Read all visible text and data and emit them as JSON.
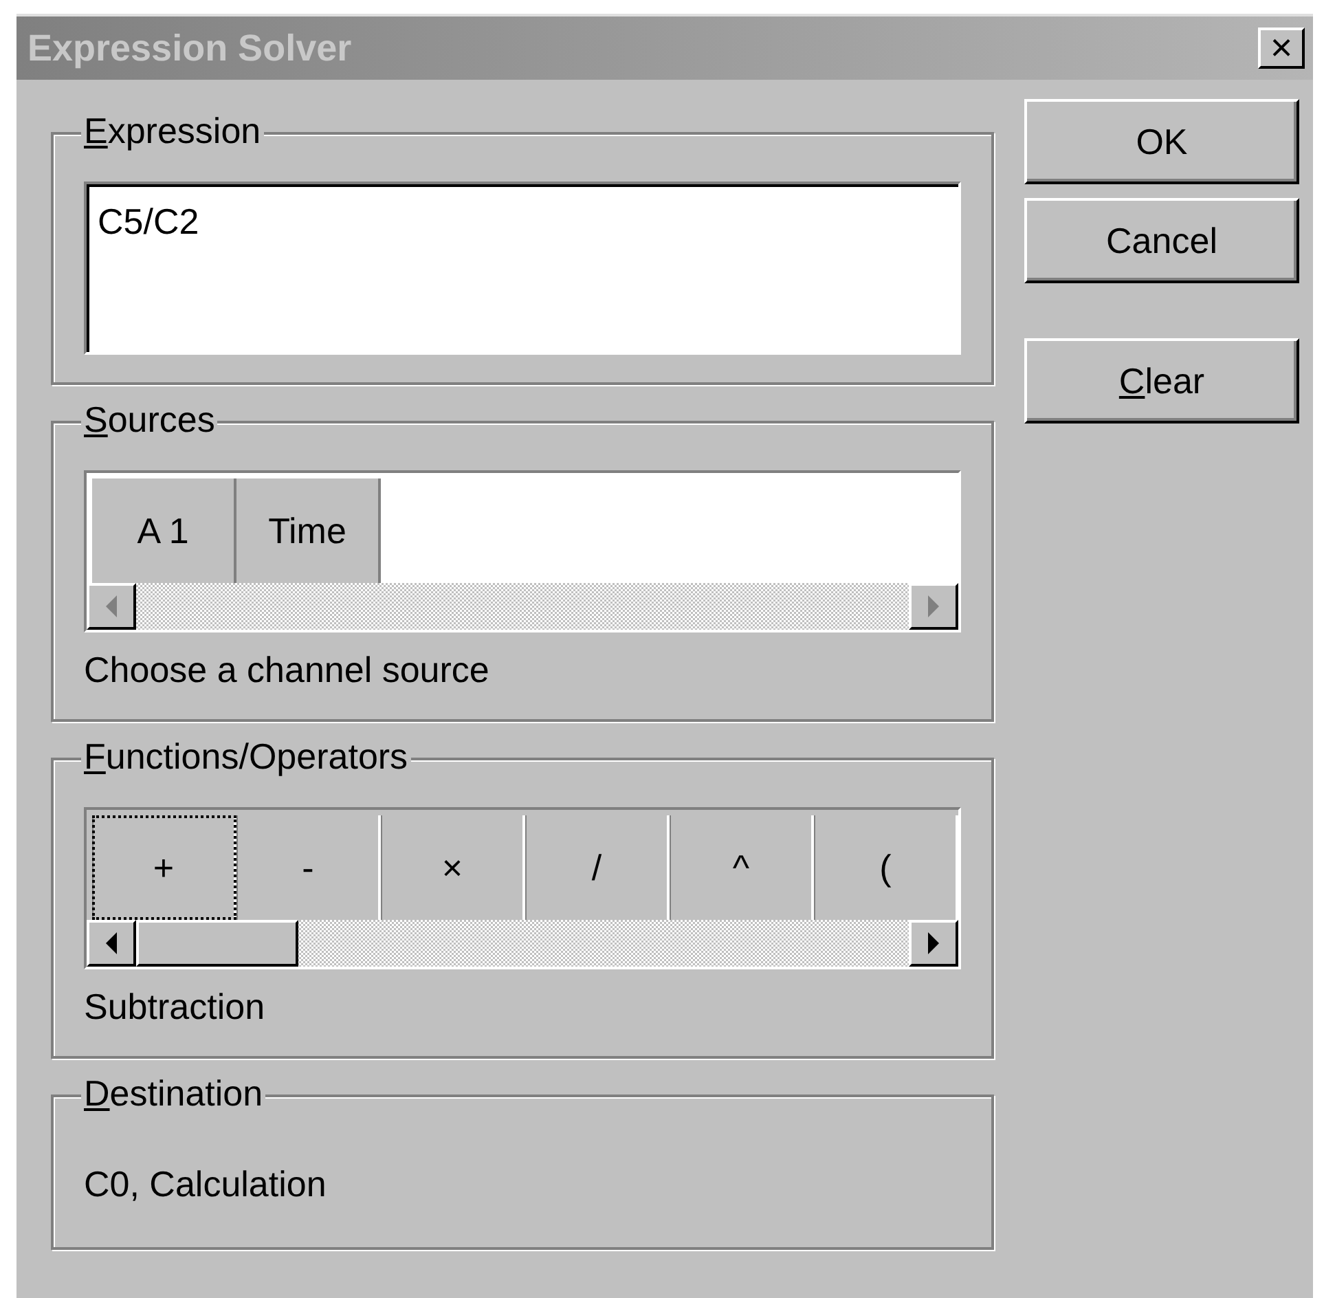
{
  "window": {
    "title": "Expression Solver",
    "close": "×"
  },
  "expression": {
    "label": "Expression",
    "mnemonic": true,
    "value": "C5/C2"
  },
  "sources": {
    "label": "Sources",
    "mnemonic": true,
    "items": [
      {
        "label": "A 1",
        "selected": false
      },
      {
        "label": "Time",
        "selected": false
      }
    ],
    "hint": "Choose a channel source"
  },
  "functions": {
    "label": "Functions/Operators",
    "mnemonic": true,
    "items": [
      {
        "label": "+",
        "selected": true
      },
      {
        "label": "-",
        "selected": false
      },
      {
        "label": "×",
        "selected": false
      },
      {
        "label": "/",
        "selected": false
      },
      {
        "label": "^",
        "selected": false
      },
      {
        "label": "(",
        "selected": false
      }
    ],
    "hint": "Subtraction"
  },
  "destination": {
    "label": "Destination",
    "mnemonic": true,
    "value": "C0, Calculation"
  },
  "buttons": [
    {
      "label": "OK",
      "mnemonic": false
    },
    {
      "label": "Cancel",
      "mnemonic": false
    },
    {
      "label": "Clear",
      "mnemonic": true
    }
  ]
}
